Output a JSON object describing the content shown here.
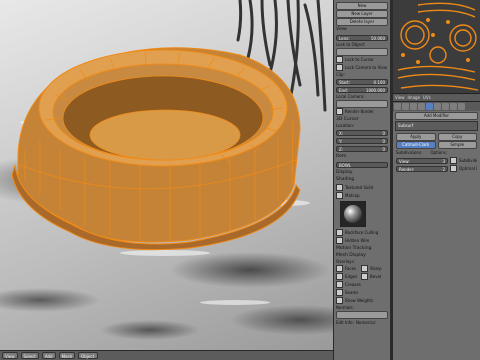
{
  "npanel": {
    "top_buttons": [
      "New",
      "New Layer"
    ],
    "delete_label": "Delete layer",
    "view_section": "View",
    "lens_field": {
      "label": "Lens:",
      "value": "50.000"
    },
    "lock_label": "Lock to Object",
    "lock_cursor": "Lock to Cursor",
    "lock_camera": "Lock Camera to View",
    "clip_section": "Clip:",
    "clip_start": {
      "label": "Start:",
      "value": "0.100"
    },
    "clip_end": {
      "label": "End:",
      "value": "1000.000"
    },
    "local_camera": "Local Camera:",
    "render_border": "Render Border",
    "cursor_section": "3D Cursor",
    "location_label": "Location:",
    "x_field": {
      "label": "X:",
      "value": "0"
    },
    "y_field": {
      "label": "Y:",
      "value": "0"
    },
    "z_field": {
      "label": "Z:",
      "value": "0"
    },
    "item_section": "Item",
    "item_name": "BOWL",
    "display_section": "Display",
    "shading_section": "Shading",
    "textured_solid": "Textured Solid",
    "matcap": "Matcap",
    "backface_culling": "Backface Culling",
    "hidden_wire": "Hidden Wire",
    "motion_tracking": "Motion Tracking",
    "mesh_display": "Mesh Display",
    "overlays_label": "Overlays:",
    "faces": "Faces",
    "edges": "Edges",
    "creases": "Creases",
    "seams": "Seams",
    "sharp": "Sharp",
    "bevel": "Bevel",
    "show_weights": "Show Weights",
    "normals_label": "Normals:",
    "edit_info": "Edit Info:",
    "numerics": "Numerics:"
  },
  "header": {
    "view": "View",
    "select": "Select",
    "add": "Add",
    "mesh": "Mesh",
    "mode": "Object"
  },
  "uv_header": {
    "view": "View",
    "image": "Image",
    "uvs": "UVs"
  },
  "modifier_panel": {
    "add_modifier": "Add Modifier",
    "modifier_name": "Subsurf",
    "apply": "Apply",
    "copy": "Copy",
    "catmull": "Catmull-Clark",
    "simple": "Simple",
    "subdivisions": "Subdivisions:",
    "view": "View:",
    "view_val": "3",
    "render": "Render:",
    "render_val": "2",
    "options": "Options:",
    "subdivide_uvs": "Subdivide UVs",
    "optimal_display": "Optimal Display"
  },
  "colors": {
    "bowl": "#e0a04f",
    "wire": "#f08a16",
    "accent": "#5680c2"
  }
}
